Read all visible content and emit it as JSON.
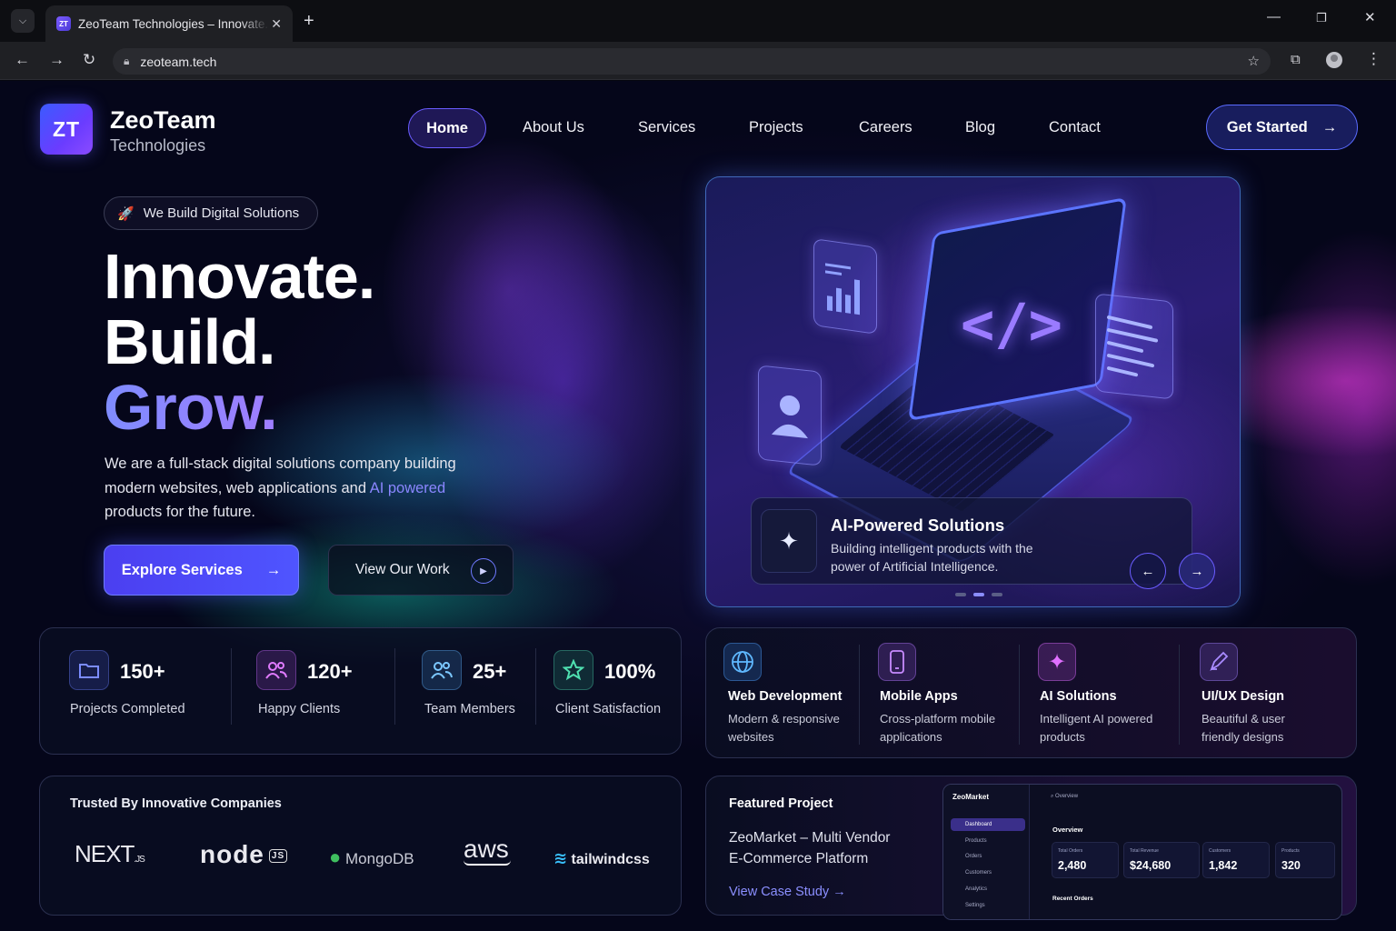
{
  "browser": {
    "tab_title": "ZeoTeam Technologies – Innovate. Build. Grow.",
    "tab_favicon": "ZT",
    "url": "zeoteam.tech"
  },
  "brand": {
    "mark": "ZT",
    "name": "ZeoTeam",
    "subtitle": "Technologies"
  },
  "nav": {
    "items": [
      "Home",
      "About Us",
      "Services",
      "Projects",
      "Careers",
      "Blog",
      "Contact"
    ],
    "active": "Home",
    "cta": "Get Started"
  },
  "hero": {
    "badge": "We Build Digital Solutions",
    "badge_icon": "rocket-icon",
    "line1": "Innovate.",
    "line2": "Build.",
    "line3": "Grow.",
    "description_pre": "We are a full-stack digital solutions company building modern websites, web applications and ",
    "description_highlight": "AI powered",
    "description_post": " products for the future.",
    "primary_button": "Explore Services",
    "secondary_button": "View Our Work"
  },
  "hero_card": {
    "title": "AI-Powered Solutions",
    "description": "Building intelligent products with the power of Artificial Intelligence.",
    "active_slide": 2,
    "slide_count": 3
  },
  "stats": [
    {
      "icon": "folder-icon",
      "value": "150+",
      "label": "Projects Completed",
      "color": "#7b8cff"
    },
    {
      "icon": "users-icon",
      "value": "120+",
      "label": "Happy Clients",
      "color": "#e07bff"
    },
    {
      "icon": "team-icon",
      "value": "25+",
      "label": "Team Members",
      "color": "#7cc8ff"
    },
    {
      "icon": "star-icon",
      "value": "100%",
      "label": "Client Satisfaction",
      "color": "#4fe0b0"
    }
  ],
  "services": [
    {
      "icon": "globe-icon",
      "title": "Web Development",
      "description": "Modern & responsive websites",
      "color": "#5fb8ff"
    },
    {
      "icon": "mobile-icon",
      "title": "Mobile Apps",
      "description": "Cross-platform mobile applications",
      "color": "#c88bff"
    },
    {
      "icon": "sparkle-icon",
      "title": "AI Solutions",
      "description": "Intelligent AI powered products",
      "color": "#e070ff"
    },
    {
      "icon": "pen-icon",
      "title": "UI/UX Design",
      "description": "Beautiful & user friendly designs",
      "color": "#a98bff"
    }
  ],
  "trusted": {
    "title": "Trusted By Innovative Companies",
    "logos": [
      "NEXT.JS",
      "node JS",
      "MongoDB",
      "aws",
      "tailwindcss"
    ]
  },
  "featured": {
    "label": "Featured Project",
    "name": "ZeoMarket – Multi Vendor E-Commerce Platform",
    "link": "View Case Study",
    "dashboard": {
      "brand": "ZeoMarket",
      "search": "Overview",
      "menu": [
        "Dashboard",
        "Products",
        "Orders",
        "Customers",
        "Analytics",
        "Settings"
      ],
      "overview": "Overview",
      "kpis": [
        {
          "label": "Total Orders",
          "value": "2,480"
        },
        {
          "label": "Total Revenue",
          "value": "$24,680"
        },
        {
          "label": "Customers",
          "value": "1,842"
        },
        {
          "label": "Products",
          "value": "320"
        }
      ],
      "recent": "Recent Orders"
    }
  },
  "colors": {
    "accent": "#5a5cff",
    "accent_text": "#8a86ff",
    "background": "#05061a"
  }
}
